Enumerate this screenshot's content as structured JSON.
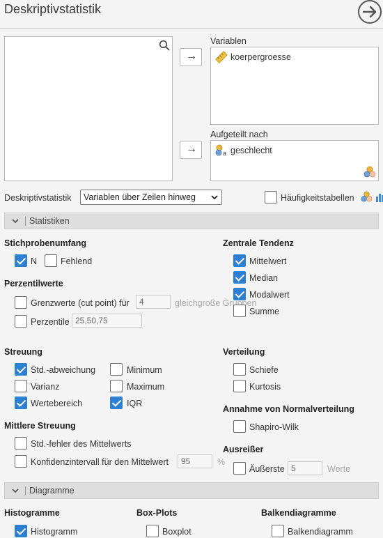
{
  "header": {
    "title": "Deskriptivstatistik"
  },
  "variables": {
    "label": "Variablen",
    "items": [
      {
        "name": "koerpergroesse",
        "icon": "ruler-icon"
      }
    ]
  },
  "split_by": {
    "label": "Aufgeteilt nach",
    "items": [
      {
        "name": "geschlecht",
        "icon": "nominal-variable-icon"
      }
    ]
  },
  "arrow_symbol": "→",
  "layout_row": {
    "label": "Deskriptivstatistik",
    "select_value": "Variablen über Zeilen hinweg",
    "frequency_tables_label": "Häufigkeitstabellen",
    "frequency_tables_checked": false
  },
  "sections": {
    "statistics": "Statistiken",
    "diagrams": "Diagramme"
  },
  "sample_size": {
    "heading": "Stichprobenumfang",
    "n": {
      "label": "N",
      "checked": true
    },
    "missing": {
      "label": "Fehlend",
      "checked": false
    }
  },
  "percentiles": {
    "heading": "Perzentilwerte",
    "cutpoints": {
      "label": "Grenzwerte (cut point) für",
      "value": "4",
      "suffix": "gleichgroße Gruppen",
      "checked": false
    },
    "percentiles": {
      "label": "Perzentile",
      "value": "25,50,75",
      "checked": false
    }
  },
  "central_tendency": {
    "heading": "Zentrale Tendenz",
    "mean": {
      "label": "Mittelwert",
      "checked": true
    },
    "median": {
      "label": "Median",
      "checked": true
    },
    "mode": {
      "label": "Modalwert",
      "checked": true
    },
    "sum": {
      "label": "Summe",
      "checked": false
    }
  },
  "dispersion": {
    "heading": "Streuung",
    "sd": {
      "label": "Std.-abweichung",
      "checked": true
    },
    "minimum": {
      "label": "Minimum",
      "checked": false
    },
    "variance": {
      "label": "Varianz",
      "checked": false
    },
    "maximum": {
      "label": "Maximum",
      "checked": false
    },
    "range": {
      "label": "Wertebereich",
      "checked": true
    },
    "iqr": {
      "label": "IQR",
      "checked": true
    }
  },
  "mean_dispersion": {
    "heading": "Mittlere Streuung",
    "se": {
      "label": "Std.-fehler des Mittelwerts",
      "checked": false
    },
    "ci": {
      "label": "Konfidenzintervall für den Mittelwert",
      "value": "95",
      "unit": "%",
      "checked": false
    }
  },
  "distribution": {
    "heading": "Verteilung",
    "skewness": {
      "label": "Schiefe",
      "checked": false
    },
    "kurtosis": {
      "label": "Kurtosis",
      "checked": false
    }
  },
  "normality": {
    "heading": "Annahme von Normalverteilung",
    "shapiro": {
      "label": "Shapiro-Wilk",
      "checked": false
    }
  },
  "outliers": {
    "heading": "Ausreißer",
    "extreme": {
      "label": "Äußerste",
      "value": "5",
      "unit": "Werte",
      "checked": false
    }
  },
  "diagrams": {
    "histograms": {
      "heading": "Histogramme",
      "histogram": {
        "label": "Histogramm",
        "checked": true
      }
    },
    "boxplots": {
      "heading": "Box-Plots",
      "boxplot": {
        "label": "Boxplot",
        "checked": false
      }
    },
    "barplots": {
      "heading": "Balkendiagramme",
      "barplot": {
        "label": "Balkendiagramm",
        "checked": false
      }
    }
  },
  "colors": {
    "accent": "#2d7fd3",
    "panel_bg": "#f4f4f4",
    "section_bg": "#dedede"
  }
}
